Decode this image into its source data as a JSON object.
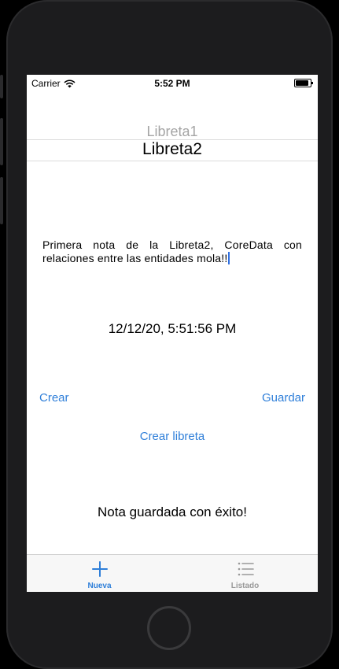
{
  "status_bar": {
    "carrier": "Carrier",
    "time": "5:52 PM"
  },
  "picker": {
    "previous_item": "Libreta1",
    "selected_item": "Libreta2"
  },
  "note": {
    "text": "Primera nota de la Libreta2, CoreData con relaciones entre las entidades mola!!"
  },
  "date_label": "12/12/20, 5:51:56 PM",
  "actions": {
    "crear": "Crear",
    "guardar": "Guardar",
    "crear_libreta": "Crear libreta"
  },
  "status_message": "Nota guardada con éxito!",
  "tab_bar": {
    "tabs": [
      {
        "label": "Nueva",
        "icon": "plus-icon",
        "active": true
      },
      {
        "label": "Listado",
        "icon": "list-icon",
        "active": false
      }
    ]
  },
  "colors": {
    "accent": "#2f7fd9",
    "inactive_tab": "#999999"
  }
}
